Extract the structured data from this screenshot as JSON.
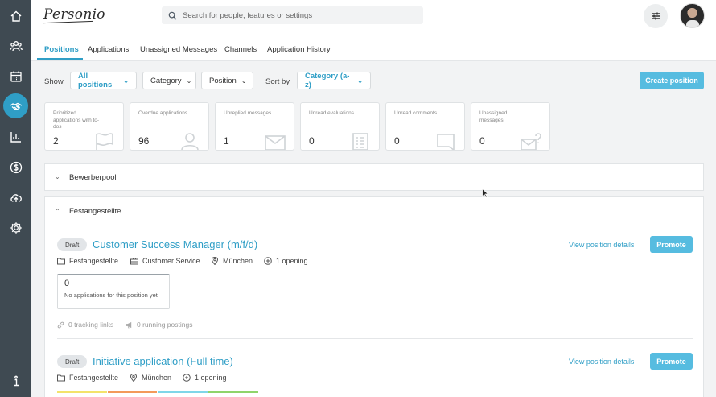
{
  "app": {
    "logo_text": "Personio"
  },
  "search": {
    "placeholder": "Search for people, features or settings"
  },
  "sidebar": {
    "items": [
      {
        "icon": "home-icon"
      },
      {
        "icon": "people-icon"
      },
      {
        "icon": "calendar-icon"
      },
      {
        "icon": "handshake-icon",
        "active": true
      },
      {
        "icon": "bar-chart-icon"
      },
      {
        "icon": "dollar-icon"
      },
      {
        "icon": "cloud-upload-icon"
      },
      {
        "icon": "gear-icon"
      },
      {
        "icon": "info-icon"
      }
    ]
  },
  "tabs": [
    {
      "label": "Positions",
      "active": true
    },
    {
      "label": "Applications"
    },
    {
      "label": "Unassigned Messages"
    },
    {
      "label": "Channels"
    },
    {
      "label": "Application History"
    }
  ],
  "filters": {
    "show_label": "Show",
    "all_positions": "All positions",
    "category": "Category",
    "position": "Position",
    "sort_by_label": "Sort by",
    "sort_value": "Category (a-z)",
    "create_button": "Create position"
  },
  "stats": [
    {
      "label": "Prioritized applications with to-dos",
      "value": "2",
      "icon": "flag-icon"
    },
    {
      "label": "Overdue applications",
      "value": "96",
      "icon": "person-icon"
    },
    {
      "label": "Unreplied messages",
      "value": "1",
      "icon": "envelope-icon"
    },
    {
      "label": "Unread evaluations",
      "value": "0",
      "icon": "clipboard-icon"
    },
    {
      "label": "Unread comments",
      "value": "0",
      "icon": "comment-icon"
    },
    {
      "label": "Unassigned messages",
      "value": "0",
      "icon": "envelope-question-icon"
    }
  ],
  "sections": {
    "pool": {
      "title": "Bewerberpool",
      "expanded": false
    },
    "permanent": {
      "title": "Festangestellte",
      "expanded": true,
      "positions": [
        {
          "status": "Draft",
          "title": "Customer Success Manager (m/f/d)",
          "employment": "Festangestellte",
          "department": "Customer Service",
          "location": "München",
          "openings": "1 opening",
          "view_details": "View position details",
          "promote": "Promote",
          "applications_count": "0",
          "applications_text": "No applications for this position yet",
          "tracking_links": "0 tracking links",
          "running_postings": "0 running postings"
        },
        {
          "status": "Draft",
          "title": "Initiative application (Full time)",
          "employment": "Festangestellte",
          "location": "München",
          "openings": "1 opening",
          "view_details": "View position details",
          "promote": "Promote"
        }
      ]
    }
  },
  "colors": {
    "accent": "#2f9ec6",
    "button": "#56bce0",
    "sidebar": "#3f4a52",
    "stage_colors": [
      "#f3e36b",
      "#f39a5a",
      "#7fd6e8",
      "#8fd46a"
    ]
  }
}
